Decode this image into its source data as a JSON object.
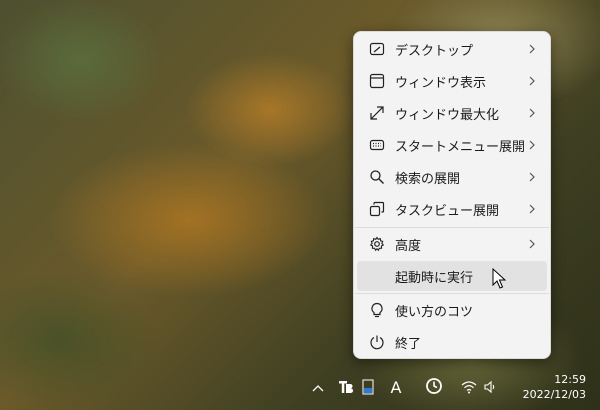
{
  "menu": {
    "items": [
      {
        "label": "デスクトップ",
        "icon": "desktop-icon",
        "submenu": true
      },
      {
        "label": "ウィンドウ表示",
        "icon": "window-icon",
        "submenu": true
      },
      {
        "label": "ウィンドウ最大化",
        "icon": "maximize-arrow-icon",
        "submenu": true
      },
      {
        "label": "スタートメニュー展開",
        "icon": "keyboard-icon",
        "submenu": true
      },
      {
        "label": "検索の展開",
        "icon": "search-icon",
        "submenu": true
      },
      {
        "label": "タスクビュー展開",
        "icon": "task-view-icon",
        "submenu": true
      },
      {
        "label": "高度",
        "icon": "gear-icon",
        "submenu": true
      },
      {
        "label": "起動時に実行",
        "icon": "",
        "submenu": false
      },
      {
        "label": "使い方のコツ",
        "icon": "lightbulb-icon",
        "submenu": false
      },
      {
        "label": "終了",
        "icon": "power-icon",
        "submenu": false
      }
    ]
  },
  "taskbar": {
    "overflow_icon": "chevron-up-icon",
    "tray_icons": [
      "tb-app-icon",
      "keyboard-layout-icon",
      "font-a-icon",
      "clock-app-icon",
      "wifi-icon",
      "volume-icon"
    ],
    "font_label": "A",
    "time": "12:59",
    "date": "2022/12/03"
  },
  "colors": {
    "menu_bg": "#f3f3f3",
    "hover": "#e2e2e2",
    "text": "#1b1b1b"
  }
}
